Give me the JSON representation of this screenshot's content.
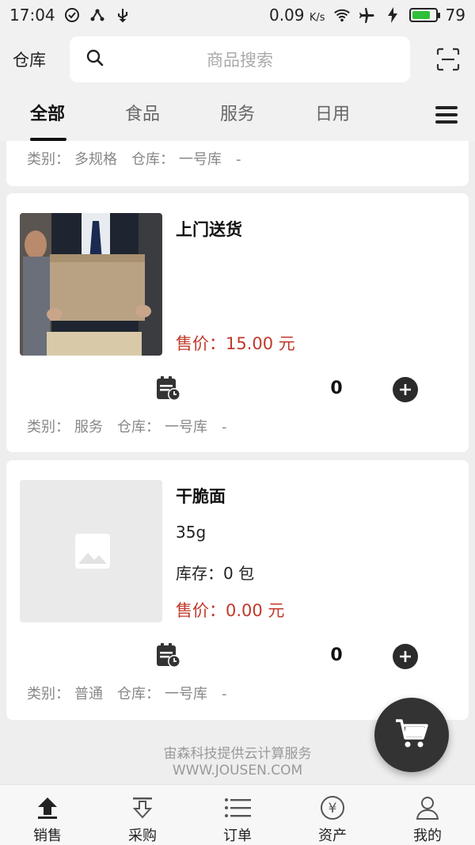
{
  "status_bar": {
    "time": "17:04",
    "speed": "0.09",
    "speed_unit": "K/s",
    "battery": "79",
    "battery_fill": 0.79
  },
  "header": {
    "warehouse_label": "仓库",
    "search_placeholder": "商品搜索",
    "search_icon": "search-icon",
    "scan_icon": "scan-icon"
  },
  "tabs": [
    {
      "label": "全部",
      "active": true
    },
    {
      "label": "食品",
      "active": false
    },
    {
      "label": "服务",
      "active": false
    },
    {
      "label": "日用",
      "active": false
    }
  ],
  "partial_item": {
    "meta": {
      "category_label": "类别：",
      "category": "多规格",
      "warehouse_label": "仓库：",
      "warehouse": "一号库",
      "dash": "-"
    }
  },
  "items": [
    {
      "name": "上门送货",
      "price_label": "售价：",
      "price": "15.00 元",
      "qty": "0",
      "meta": {
        "category_label": "类别：",
        "category": "服务",
        "warehouse_label": "仓库：",
        "warehouse": "一号库",
        "dash": "-"
      }
    },
    {
      "name": "干脆面",
      "spec": "35g",
      "stock_label": "库存：",
      "stock": "0 包",
      "price_label": "售价：",
      "price": "0.00 元",
      "qty": "0",
      "meta": {
        "category_label": "类别：",
        "category": "普通",
        "warehouse_label": "仓库：",
        "warehouse": "一号库",
        "dash": "-"
      }
    }
  ],
  "footer": {
    "line1": "宙森科技提供云计算服务",
    "line2": "WWW.JOUSEN.COM"
  },
  "bottom_nav": [
    {
      "label": "销售",
      "icon": "sales-icon",
      "active": true
    },
    {
      "label": "采购",
      "icon": "purchase-icon",
      "active": false
    },
    {
      "label": "订单",
      "icon": "orders-icon",
      "active": false
    },
    {
      "label": "资产",
      "icon": "assets-icon",
      "active": false
    },
    {
      "label": "我的",
      "icon": "profile-icon",
      "active": false
    }
  ],
  "colors": {
    "price": "#c0392b",
    "battery": "#2fbf3a",
    "fab": "#333333"
  }
}
